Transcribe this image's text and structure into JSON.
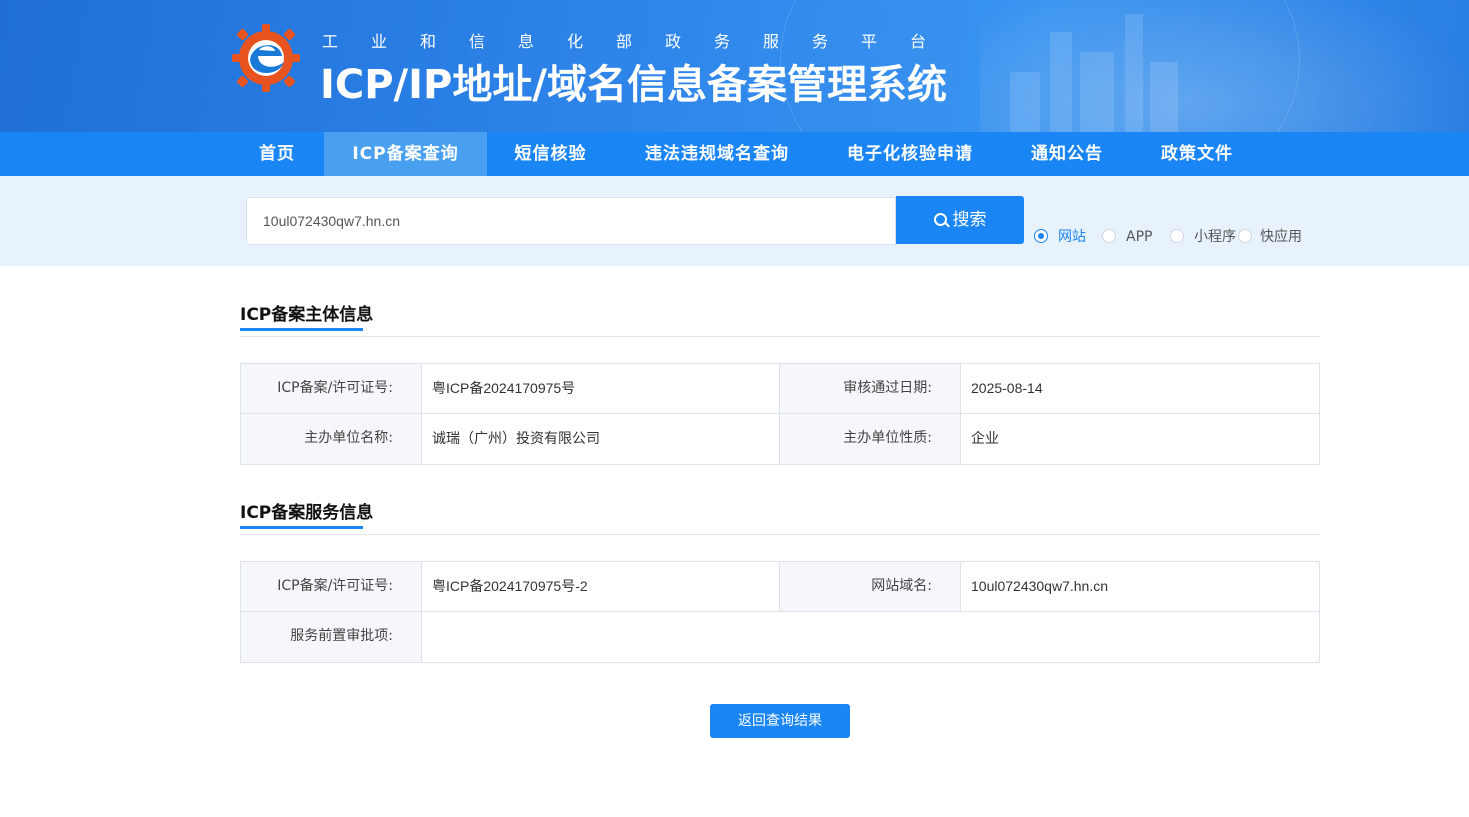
{
  "header": {
    "subtitle": "工业和信息化部政务服务平台",
    "title": "ICP/IP地址/域名信息备案管理系统"
  },
  "nav": {
    "items": [
      {
        "label": "首页"
      },
      {
        "label": "ICP备案查询"
      },
      {
        "label": "短信核验"
      },
      {
        "label": "违法违规域名查询"
      },
      {
        "label": "电子化核验申请"
      },
      {
        "label": "通知公告"
      },
      {
        "label": "政策文件"
      }
    ],
    "active": "ICP备案查询"
  },
  "search": {
    "value": "10ul072430qw7.hn.cn",
    "button_label": "搜索",
    "options": [
      "网站",
      "APP",
      "小程序",
      "快应用"
    ],
    "selected": "网站"
  },
  "subject_section": {
    "title": "ICP备案主体信息",
    "rows": [
      {
        "label1": "ICP备案/许可证号:",
        "value1": "粤ICP备2024170975号",
        "label2": "审核通过日期:",
        "value2": "2025-08-14"
      },
      {
        "label1": "主办单位名称:",
        "value1": "诚瑞（广州）投资有限公司",
        "label2": "主办单位性质:",
        "value2": "企业"
      }
    ]
  },
  "service_section": {
    "title": "ICP备案服务信息",
    "rows": [
      {
        "label1": "ICP备案/许可证号:",
        "value1": "粤ICP备2024170975号-2",
        "label2": "网站域名:",
        "value2": "10ul072430qw7.hn.cn"
      },
      {
        "label1": "服务前置审批项:",
        "value1": ""
      }
    ]
  },
  "back_button": "返回查询结果",
  "colors": {
    "primary": "#1a85f4",
    "nav_active": "#4aa0f0",
    "search_band": "#e8f2fc"
  }
}
